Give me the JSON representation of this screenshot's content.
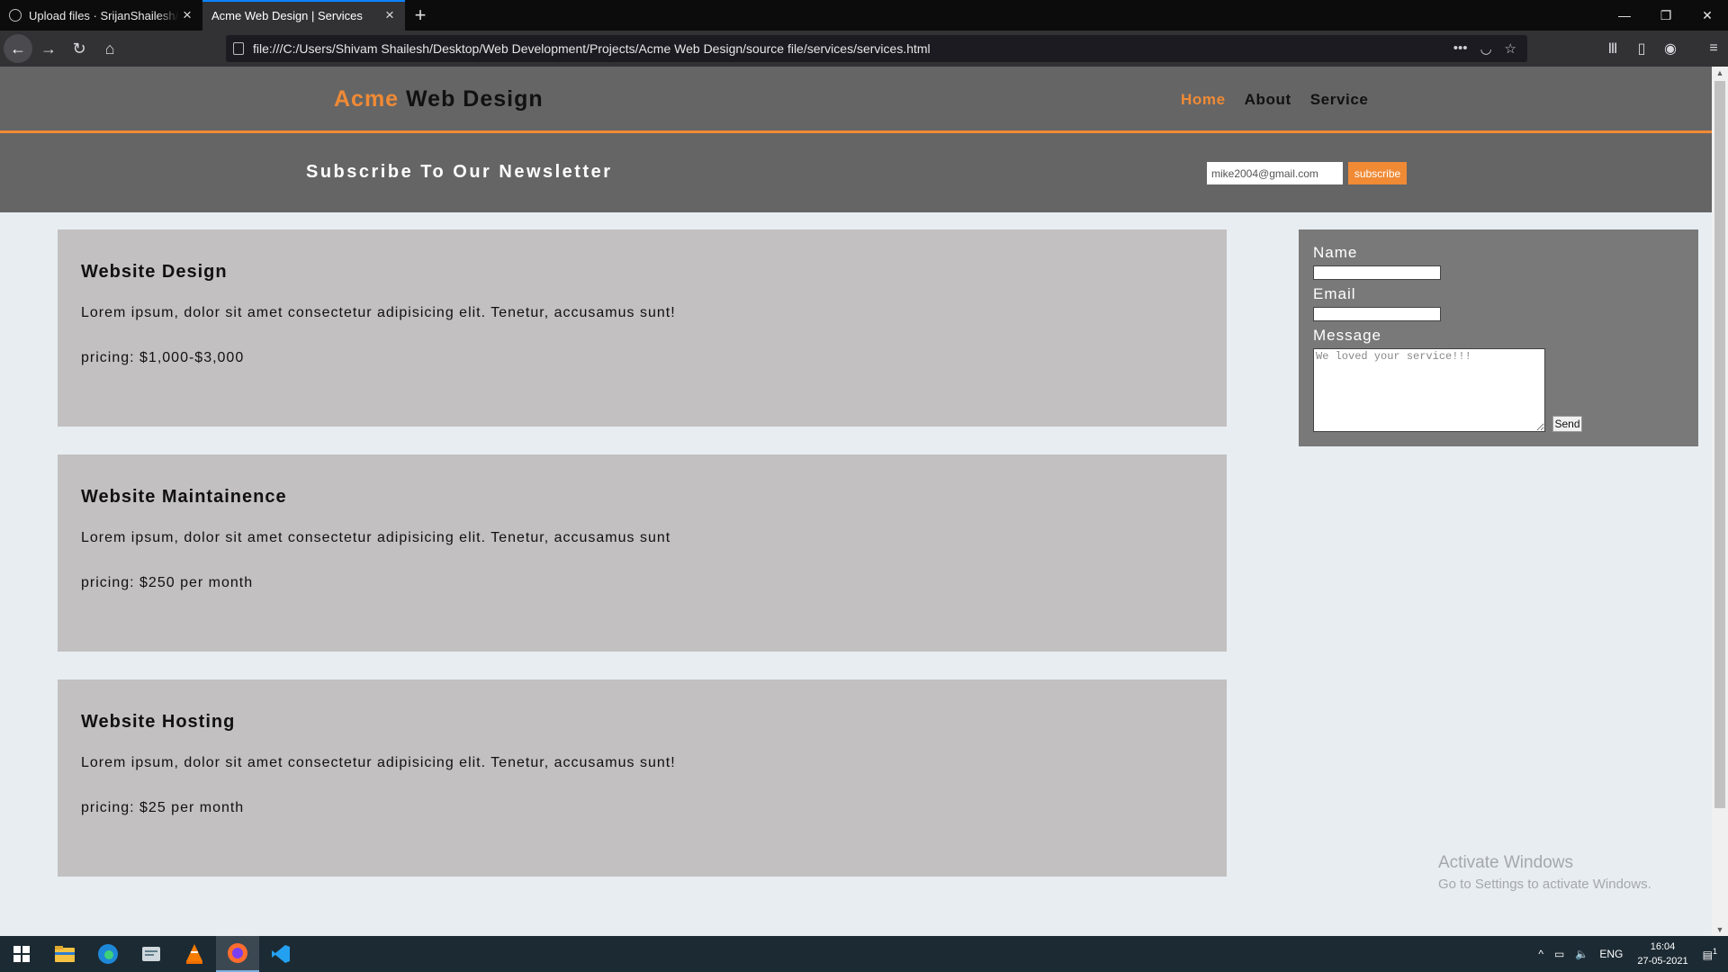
{
  "browser": {
    "tabs": [
      {
        "title": "Upload files · SrijanShailesh/proj",
        "active": false
      },
      {
        "title": "Acme Web Design | Services",
        "active": true
      }
    ],
    "url": "file:///C:/Users/Shivam Shailesh/Desktop/Web Development/Projects/Acme Web Design/source file/services/services.html"
  },
  "site": {
    "logo_highlight": "Acme",
    "logo_rest": " Web Design",
    "nav": [
      {
        "label": "Home",
        "current": true
      },
      {
        "label": "About",
        "current": false
      },
      {
        "label": "Service",
        "current": false
      }
    ],
    "accent_color": "#f08a35"
  },
  "newsletter": {
    "heading": "Subscribe To Our Newsletter",
    "email_value": "mike2004@gmail.com",
    "button_label": "subscribe"
  },
  "services": [
    {
      "title": "Website Design",
      "description": "Lorem ipsum, dolor sit amet consectetur adipisicing elit. Tenetur, accusamus sunt!",
      "pricing": "pricing: $1,000-$3,000"
    },
    {
      "title": "Website Maintainence",
      "description": "Lorem ipsum, dolor sit amet consectetur adipisicing elit. Tenetur, accusamus sunt",
      "pricing": "pricing: $250 per month"
    },
    {
      "title": "Website Hosting",
      "description": "Lorem ipsum, dolor sit amet consectetur adipisicing elit. Tenetur, accusamus sunt!",
      "pricing": "pricing: $25 per month"
    }
  ],
  "contact_form": {
    "name_label": "Name",
    "email_label": "Email",
    "message_label": "Message",
    "message_value": "We loved your service!!!",
    "send_label": "Send"
  },
  "watermark": {
    "line1": "Activate Windows",
    "line2": "Go to Settings to activate Windows."
  },
  "taskbar": {
    "language": "ENG",
    "time": "16:04",
    "date": "27-05-2021",
    "notification_count": "1"
  }
}
